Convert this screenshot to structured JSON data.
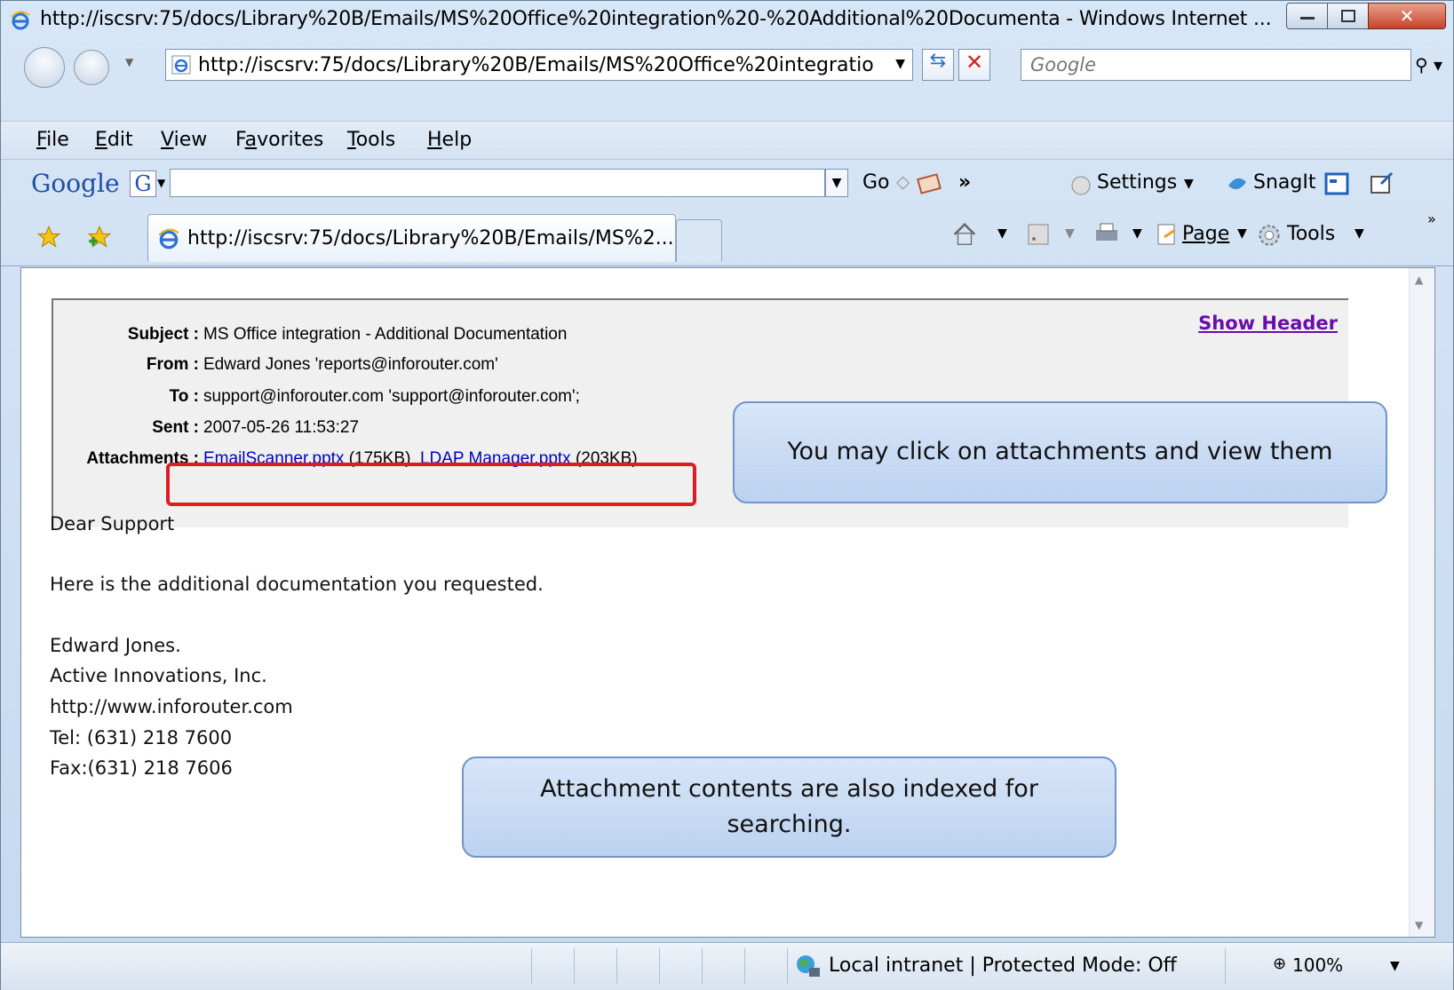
{
  "window": {
    "title": "http://iscsrv:75/docs/Library%20B/Emails/MS%20Office%20integration%20-%20Additional%20Documenta - Windows Internet ...",
    "buttons": [
      "minimize",
      "maximize",
      "close"
    ]
  },
  "address_bar": {
    "url": "http://iscsrv:75/docs/Library%20B/Emails/MS%20Office%20integration%",
    "search_placeholder": "Google"
  },
  "menu": {
    "items": [
      "File",
      "Edit",
      "View",
      "Favorites",
      "Tools",
      "Help"
    ]
  },
  "google_toolbar": {
    "logo": "Google",
    "g_button": "G",
    "go_label": "Go",
    "more": "»",
    "settings_label": "Settings",
    "snagit_label": "SnagIt"
  },
  "tabs": {
    "active_tab": "http://iscsrv:75/docs/Library%20B/Emails/MS%2...",
    "page_label": "Page",
    "tools_label": "Tools",
    "chevron": "»"
  },
  "email": {
    "show_header": "Show Header",
    "subject_label": "Subject :",
    "subject": "MS Office integration - Additional Documentation",
    "from_label": "From :",
    "from": "Edward Jones 'reports@inforouter.com'",
    "to_label": "To :",
    "to": "support@inforouter.com 'support@inforouter.com';",
    "sent_label": "Sent :",
    "sent": "2007-05-26 11:53:27",
    "attachments_label": "Attachments :",
    "attachment1_name": "EmailScanner.pptx",
    "attachment1_size": "(175KB)",
    "attachment2_name": "LDAP Manager.pptx",
    "attachment2_size": "(203KB)",
    "greeting": "Dear Support",
    "line1": "Here is the additional documentation you requested.",
    "sig_name": "Edward Jones.",
    "sig_company": "Active Innovations, Inc.",
    "sig_url": "http://www.inforouter.com",
    "sig_tel": "Tel: (631) 218 7600",
    "sig_fax": "Fax:(631) 218 7606"
  },
  "callouts": {
    "attachments_tip": "You may click on attachments and view them",
    "index_tip": "Attachment contents are also indexed for searching."
  },
  "status_bar": {
    "zone": "Local intranet | Protected Mode: Off",
    "zoom": "100%"
  }
}
